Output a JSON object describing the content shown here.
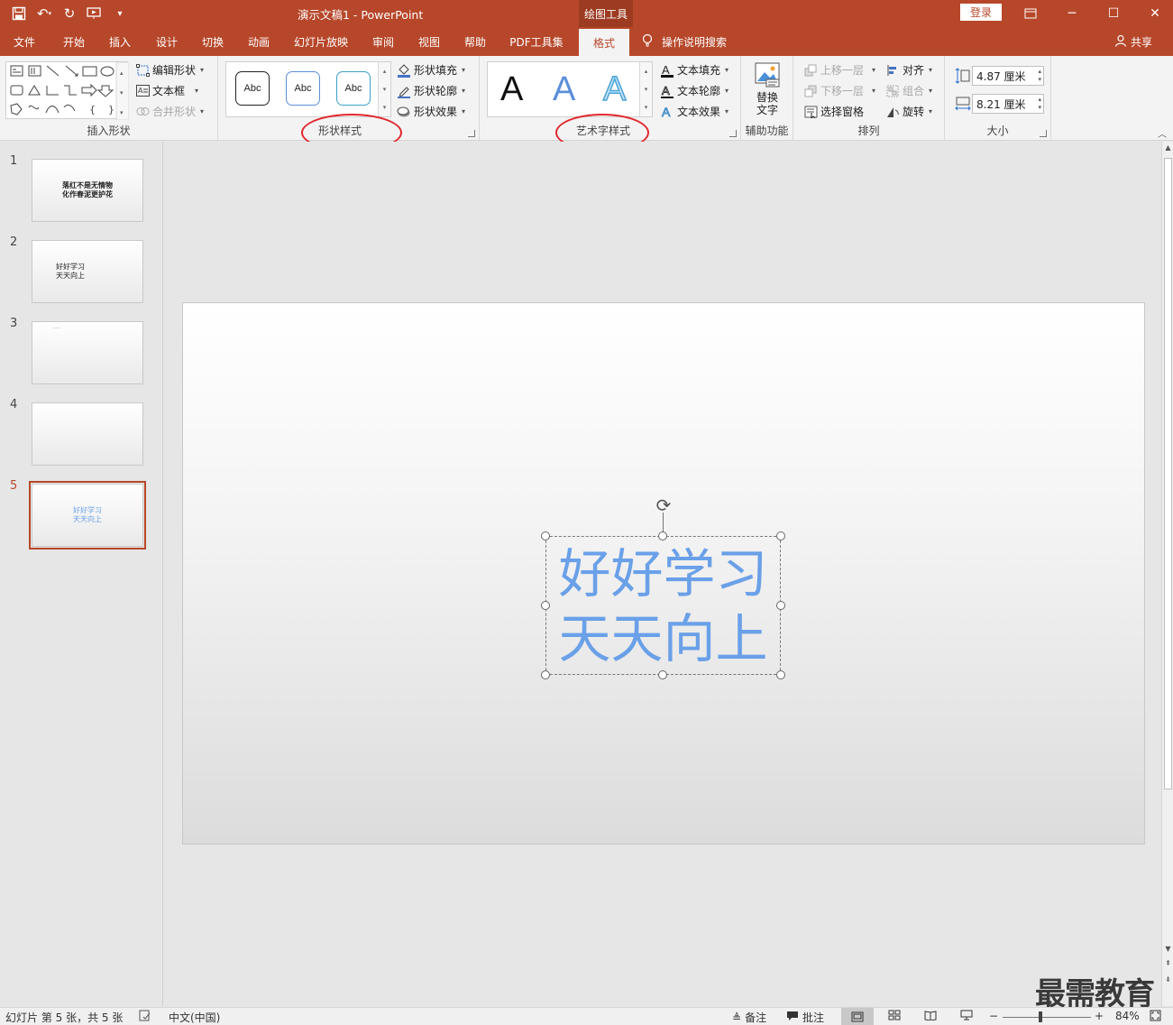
{
  "titlebar": {
    "document_title": "演示文稿1  -  PowerPoint",
    "context_tab": "绘图工具",
    "login": "登录"
  },
  "tabs": [
    "文件",
    "开始",
    "插入",
    "设计",
    "切换",
    "动画",
    "幻灯片放映",
    "审阅",
    "视图",
    "帮助",
    "PDF工具集",
    "格式"
  ],
  "active_tab": "格式",
  "tell_me": "操作说明搜索",
  "share": "共享",
  "ribbon": {
    "insert_shapes": {
      "label": "插入形状",
      "edit_shape": "编辑形状",
      "text_box": "文本框",
      "merge_shapes": "合并形状"
    },
    "shape_styles": {
      "label": "形状样式",
      "presets": [
        "Abc",
        "Abc",
        "Abc"
      ],
      "fill": "形状填充",
      "outline": "形状轮廓",
      "effects": "形状效果"
    },
    "wordart_styles": {
      "label": "艺术字样式",
      "presets": [
        "A",
        "A",
        "A"
      ],
      "text_fill": "文本填充",
      "text_outline": "文本轮廓",
      "text_effects": "文本效果"
    },
    "accessibility": {
      "label": "辅助功能",
      "alt_text_line1": "替换",
      "alt_text_line2": "文字"
    },
    "arrange": {
      "label": "排列",
      "bring_forward": "上移一层",
      "send_backward": "下移一层",
      "selection_pane": "选择窗格",
      "align": "对齐",
      "group": "组合",
      "rotate": "旋转"
    },
    "size": {
      "label": "大小",
      "height": "4.87 厘米",
      "width": "8.21 厘米"
    }
  },
  "slides": [
    {
      "num": "1",
      "lines": [
        "落红不是无情物",
        "化作春泥更护花"
      ]
    },
    {
      "num": "2",
      "lines": [
        "好好学习",
        "天天向上"
      ]
    },
    {
      "num": "3",
      "lines": [
        "......"
      ]
    },
    {
      "num": "4",
      "lines": []
    },
    {
      "num": "5",
      "lines": [
        "好好学习",
        "天天向上"
      ]
    }
  ],
  "active_slide": "5",
  "slide_content": {
    "line1": "好好学习",
    "line2": "天天向上"
  },
  "statusbar": {
    "slide_info": "幻灯片 第 5 张，共 5 张",
    "language": "中文(中国)",
    "notes": "备注",
    "comments": "批注",
    "zoom_minus": "−",
    "zoom_plus": "+",
    "zoom": "84%"
  },
  "watermark": "最需教育",
  "colors": {
    "accent": "#b7472a",
    "text_blue": "#6aa0e8",
    "annotation_red": "#e0262b"
  }
}
